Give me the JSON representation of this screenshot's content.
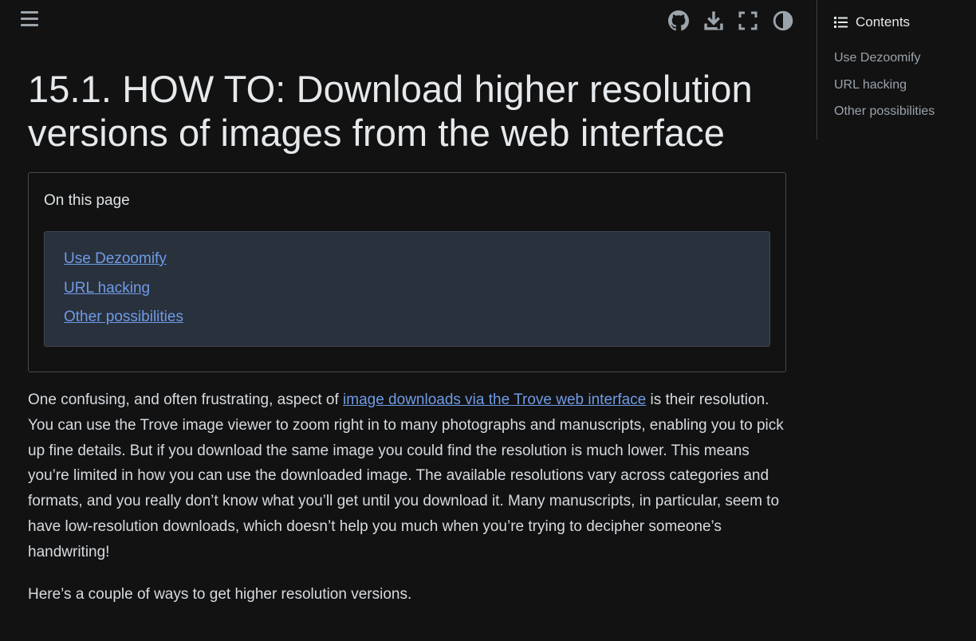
{
  "header": {
    "icons": [
      "menu-icon",
      "github-icon",
      "download-icon",
      "fullscreen-icon",
      "theme-toggle-icon"
    ]
  },
  "toc": {
    "title": "Contents",
    "items": [
      "Use Dezoomify",
      "URL hacking",
      "Other possibilities"
    ]
  },
  "main": {
    "title_line1": "15.1. HOW TO: Download higher resolution",
    "title_line2": "versions of images from the web interface",
    "on_this_page": {
      "title": "On this page",
      "links": [
        "Use Dezoomify",
        "URL hacking",
        "Other possibilities"
      ]
    },
    "paragraph1": {
      "before_link": "One confusing, and often frustrating, aspect of ",
      "link": "image downloads via the Trove web interface",
      "after_link": " is their resolution. You can use the Trove image viewer to zoom right in to many photographs and manuscripts, enabling you to pick up fine details. But if you download the same image you could find the resolution is much lower. This means you’re limited in how you can use the downloaded image. The available resolutions vary across categories and formats, and you really don’t know what you’ll get until you download it. Many manuscripts, in particular, seem to have low-resolution downloads, which doesn’t help you much when you’re trying to decipher someone’s handwriting!"
    },
    "paragraph2": "Here’s a couple of ways to get higher resolution versions."
  },
  "colors": {
    "background": "#121212",
    "link": "#6f9be6",
    "box": "#29313d",
    "text": "#d6dbe0"
  }
}
